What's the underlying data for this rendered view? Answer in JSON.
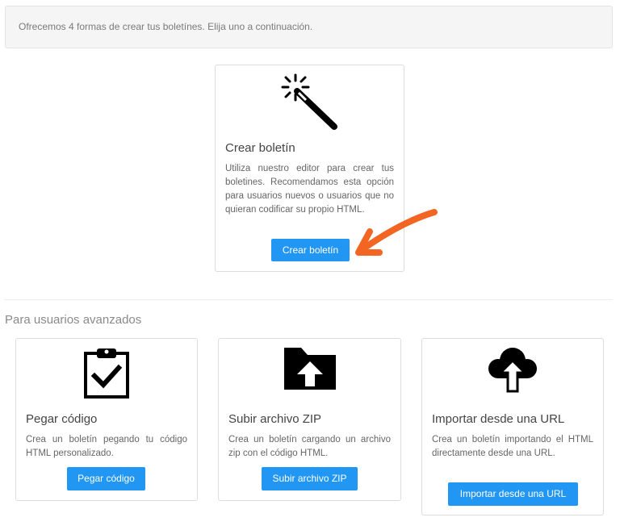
{
  "notice": {
    "text": "Ofrecemos 4 formas de crear tus boletínes. Elija uno a continuación."
  },
  "create_card": {
    "icon": "magic-wand-icon",
    "title": "Crear boletín",
    "description": "Utiliza nuestro editor para crear tus boletines. Recomendamos esta opción para usuarios nuevos o usuarios que no quieran codificar su propio HTML.",
    "button_label": "Crear boletín"
  },
  "advanced": {
    "section_title": "Para usuarios avanzados",
    "cards": [
      {
        "icon": "clipboard-check-icon",
        "title": "Pegar código",
        "description": "Crea un boletín pegando tu código HTML personalizado.",
        "button_label": "Pegar código"
      },
      {
        "icon": "folder-upload-icon",
        "title": "Subir archivo ZIP",
        "description": "Crea un boletín cargando un archivo zip con el código HTML.",
        "button_label": "Subir archivo ZIP"
      },
      {
        "icon": "cloud-upload-icon",
        "title": "Importar desde una URL",
        "description": "Crea un boletín importando el HTML directamente desde una URL.",
        "button_label": "Importar desde una URL"
      }
    ]
  },
  "colors": {
    "button": "#2196f3",
    "annotation_arrow": "#f26522"
  }
}
